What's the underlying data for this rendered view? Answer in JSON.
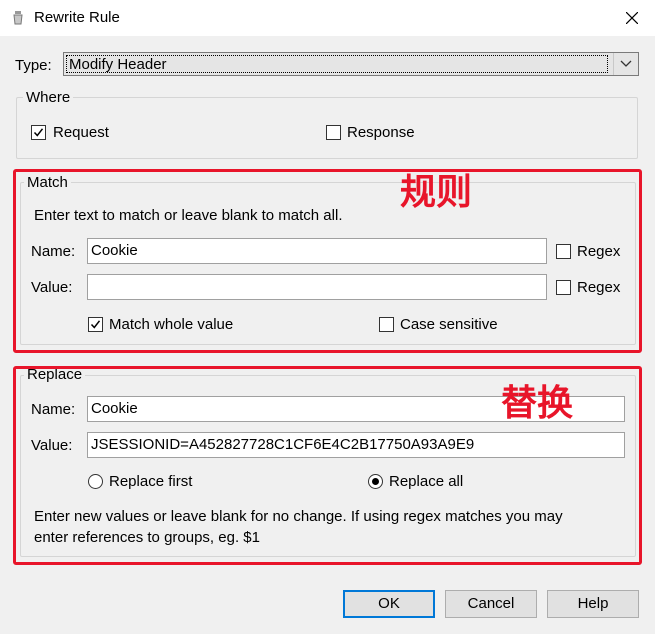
{
  "window": {
    "title": "Rewrite Rule",
    "close_icon": "close-icon"
  },
  "type_row": {
    "label": "Type:",
    "selected": "Modify Header"
  },
  "where": {
    "legend": "Where",
    "request": {
      "label": "Request",
      "checked": true
    },
    "response": {
      "label": "Response",
      "checked": false
    }
  },
  "match": {
    "legend": "Match",
    "hint": "Enter text to match or leave blank to match all.",
    "name_label": "Name:",
    "name_value": "Cookie",
    "name_regex": {
      "label": "Regex",
      "checked": false
    },
    "value_label": "Value:",
    "value_value": "",
    "value_regex": {
      "label": "Regex",
      "checked": false
    },
    "whole_value": {
      "label": "Match whole value",
      "checked": true
    },
    "case_sensitive": {
      "label": "Case sensitive",
      "checked": false
    },
    "annotation": "规则"
  },
  "replace": {
    "legend": "Replace",
    "name_label": "Name:",
    "name_value": "Cookie",
    "value_label": "Value:",
    "value_value": "JSESSIONID=A452827728C1CF6E4C2B17750A93A9E9",
    "replace_first": {
      "label": "Replace first",
      "selected": false
    },
    "replace_all": {
      "label": "Replace all",
      "selected": true
    },
    "help_line1": "Enter new values or leave blank for no change. If using regex matches you may",
    "help_line2": "enter references to groups, eg. $1",
    "annotation": "替换"
  },
  "buttons": {
    "ok": "OK",
    "cancel": "Cancel",
    "help": "Help"
  },
  "colors": {
    "annotation_red": "#e8152a",
    "default_button_border": "#0078d7"
  }
}
